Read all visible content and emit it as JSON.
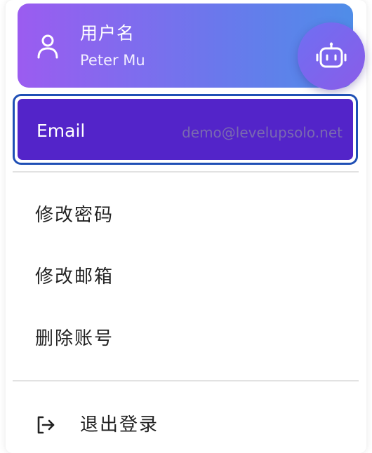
{
  "profile": {
    "username_label": "用户名",
    "username_value": "Peter Mu",
    "icon": "user-icon"
  },
  "email": {
    "label": "Email",
    "value": "demo@levelupsolo.net"
  },
  "menu": {
    "items": [
      {
        "label": "修改密码"
      },
      {
        "label": "修改邮箱"
      },
      {
        "label": "删除账号"
      }
    ],
    "logout_label": "退出登录",
    "logout_icon": "logout-icon"
  },
  "assistant": {
    "icon": "robot-icon"
  },
  "colors": {
    "card_gradient_start": "#9b5cf0",
    "card_gradient_end": "#4f8de8",
    "email_bg": "#5324c9",
    "focus_border": "#1f4fb5",
    "text": "#222222"
  }
}
